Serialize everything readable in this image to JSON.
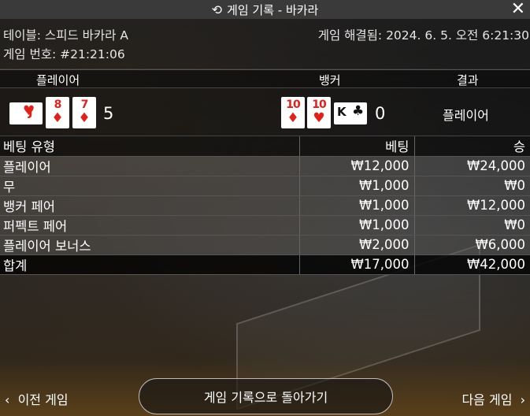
{
  "title": "게임 기록 - 바카라",
  "info": {
    "table": "테이블: 스피드 바카라 A",
    "game_number": "게임 번호: #21:21:06",
    "resolved": "게임 해결됨: 2024. 6. 5. 오전 6:21:30"
  },
  "result_header": {
    "player": "플레이어",
    "banker": "뱅커",
    "result": "결과"
  },
  "result": {
    "player_side_card": {
      "rank": "J",
      "suit": "♥"
    },
    "player_cards": [
      {
        "rank": "8",
        "suit": "♦"
      },
      {
        "rank": "7",
        "suit": "♦"
      }
    ],
    "player_score": "5",
    "banker_cards": [
      {
        "rank": "10",
        "suit": "♦"
      },
      {
        "rank": "10",
        "suit": "♥"
      }
    ],
    "banker_side_card": {
      "rank": "K",
      "suit": "♣"
    },
    "banker_score": "0",
    "winner": "플레이어"
  },
  "bets": {
    "headers": {
      "type": "베팅 유형",
      "bet": "베팅",
      "win": "승"
    },
    "rows": [
      {
        "type": "플레이어",
        "bet": "₩12,000",
        "win": "₩24,000"
      },
      {
        "type": "무",
        "bet": "₩1,000",
        "win": "₩0"
      },
      {
        "type": "뱅커 페어",
        "bet": "₩1,000",
        "win": "₩12,000"
      },
      {
        "type": "퍼펙트 페어",
        "bet": "₩1,000",
        "win": "₩0"
      },
      {
        "type": "플레이어 보너스",
        "bet": "₩2,000",
        "win": "₩6,000"
      }
    ],
    "total": {
      "type": "합계",
      "bet": "₩17,000",
      "win": "₩42,000"
    }
  },
  "footer": {
    "prev": "이전 게임",
    "back": "게임 기록으로 돌아가기",
    "next": "다음 게임"
  },
  "icons": {
    "history": "history-icon",
    "close": "close-icon",
    "prev": "chevron-left-icon",
    "next": "chevron-right-icon"
  },
  "colors": {
    "card_red": "#e0201b",
    "title_bg": "#3a3a3a"
  }
}
